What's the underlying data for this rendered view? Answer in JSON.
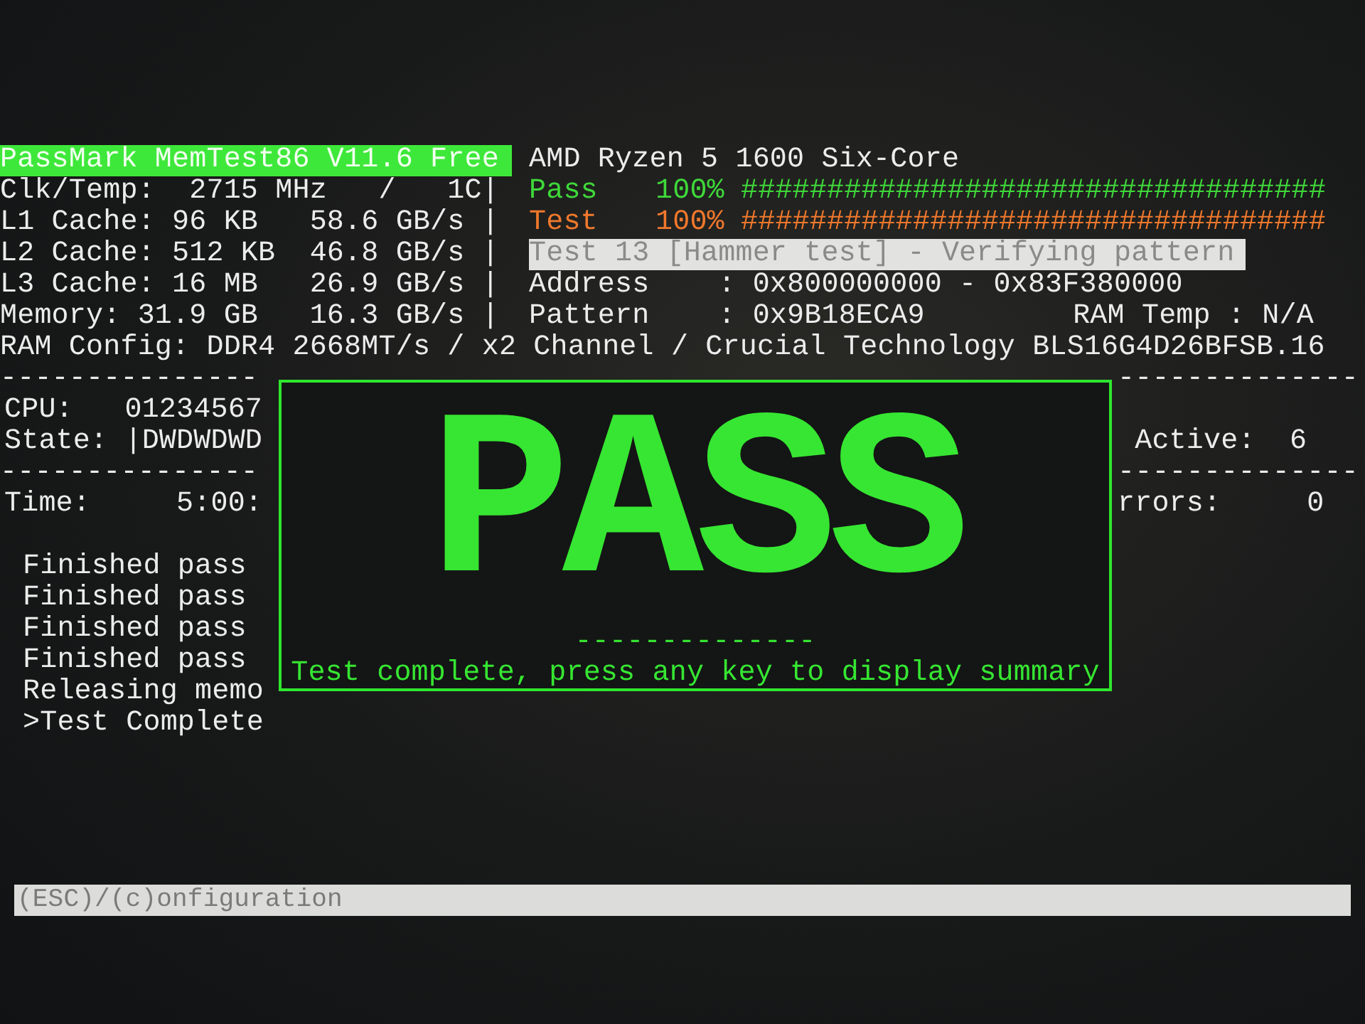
{
  "header": {
    "title": "PassMark MemTest86 V11.6 Free",
    "cpu_name": "AMD Ryzen 5 1600 Six-Core"
  },
  "system_info": [
    "Clk/Temp:  2715 MHz   /   1C|",
    "L1 Cache: 96 KB   58.6 GB/s |",
    "L2 Cache: 512 KB  46.8 GB/s |",
    "L3 Cache: 16 MB   26.9 GB/s |",
    "Memory: 31.9 GB   16.3 GB/s |"
  ],
  "progress": [
    {
      "label": "Pass",
      "percent": "100%",
      "hashes": "##################################",
      "color": "#3fd83a"
    },
    {
      "label": "Test",
      "percent": "100%",
      "hashes": "##################################",
      "color": "#f0782c"
    }
  ],
  "current_test": "Test 13 [Hammer test] - Verifying pattern",
  "address": "Address    : 0x800000000 - 0x83F380000",
  "pattern": "Pattern    : 0x9B18ECA9",
  "ram_temp": "RAM Temp : N/A",
  "ram_config": "RAM Config: DDR4 2668MT/s / x2 Channel / Crucial Technology BLS16G4D26BFSB.16",
  "left_panel": [
    {
      "kind": "divider",
      "text": "---------------"
    },
    {
      "kind": "text",
      "text": "CPU:   01234567"
    },
    {
      "kind": "text",
      "text": "State: |DWDWDWD"
    },
    {
      "kind": "divider",
      "text": "---------------"
    },
    {
      "kind": "text",
      "text": "Time:     5:00:"
    },
    {
      "kind": "blank"
    }
  ],
  "log": [
    "Finished pass",
    "Finished pass",
    "Finished pass",
    "Finished pass",
    "Releasing memo",
    ">Test Complete"
  ],
  "right_panel": [
    {
      "kind": "divider",
      "text": "--------------"
    },
    {
      "kind": "blank"
    },
    {
      "kind": "text",
      "text": " Active:  6"
    },
    {
      "kind": "divider",
      "text": "--------------"
    },
    {
      "kind": "text",
      "text": "rrors:     0"
    }
  ],
  "dialog": {
    "title": "PASS",
    "divider": "--------------",
    "message": "Test complete, press any key to display summary"
  },
  "footer": "(ESC)/(c)onfiguration"
}
